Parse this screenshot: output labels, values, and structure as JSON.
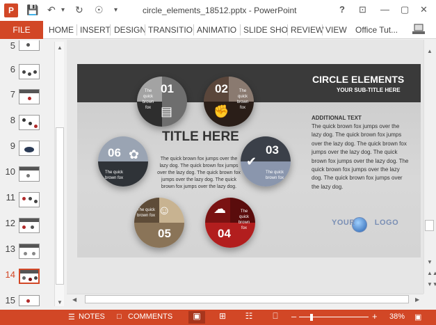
{
  "window": {
    "title": "circle_elements_18512.pptx - PowerPoint",
    "app_icon": "P",
    "controls": [
      "?",
      "⊡",
      "—",
      "▢",
      "✕"
    ]
  },
  "ribbon": {
    "file": "FILE",
    "tabs": [
      "HOME",
      "INSERT",
      "DESIGN",
      "TRANSITIO",
      "ANIMATIO",
      "SLIDE SHO",
      "REVIEW",
      "VIEW"
    ],
    "user": "Office Tut..."
  },
  "thumbnails": {
    "numbers": [
      "5",
      "6",
      "7",
      "8",
      "9",
      "10",
      "11",
      "12",
      "13",
      "14",
      "15"
    ],
    "active": "14"
  },
  "slide": {
    "title": "CIRCLE ELEMENTS",
    "subtitle": "YOUR SUB-TITLE HERE",
    "main_title": "TITLE HERE",
    "center_text": "The quick brown fox jumps over the lazy dog. The quick brown fox jumps over the lazy dog. The quick brown fox jumps over the lazy dog. The quick brown fox jumps over the lazy dog.",
    "additional_title": "ADDITIONAL TEXT",
    "additional_text": "The quick brown fox jumps over the lazy dog. The quick brown fox jumps over the lazy dog. The quick brown fox jumps over the lazy dog. The quick brown fox jumps over the lazy dog. The quick brown fox jumps over the lazy dog. The quick brown fox jumps over the lazy dog.",
    "logo_left": "YOUR",
    "logo_right": "LOGO",
    "circles": {
      "c01": {
        "num": "01",
        "text": "The quick brown fox",
        "icon": "presentation-icon"
      },
      "c02": {
        "num": "02",
        "text": "The quick brown fox",
        "icon": "thumbs-up-icon"
      },
      "c03": {
        "num": "03",
        "text": "The quick brown fox",
        "icon": "checkmark-icon"
      },
      "c04": {
        "num": "04",
        "text": "The quick brown fox",
        "icon": "cloud-icon"
      },
      "c05": {
        "num": "05",
        "text": "The quick brown fox",
        "icon": "group-icon"
      },
      "c06": {
        "num": "06",
        "text": "The quick brown fox",
        "icon": "award-icon"
      }
    }
  },
  "statusbar": {
    "notes": "NOTES",
    "comments": "COMMENTS",
    "zoom": "38%"
  },
  "colors": {
    "accent": "#d24726",
    "c01": "#6e6e6e",
    "c02": "#5a463b",
    "c03": "#3b4049",
    "c04": "#7a1212",
    "c05": "#8a7458",
    "c06": "#2f3338"
  }
}
